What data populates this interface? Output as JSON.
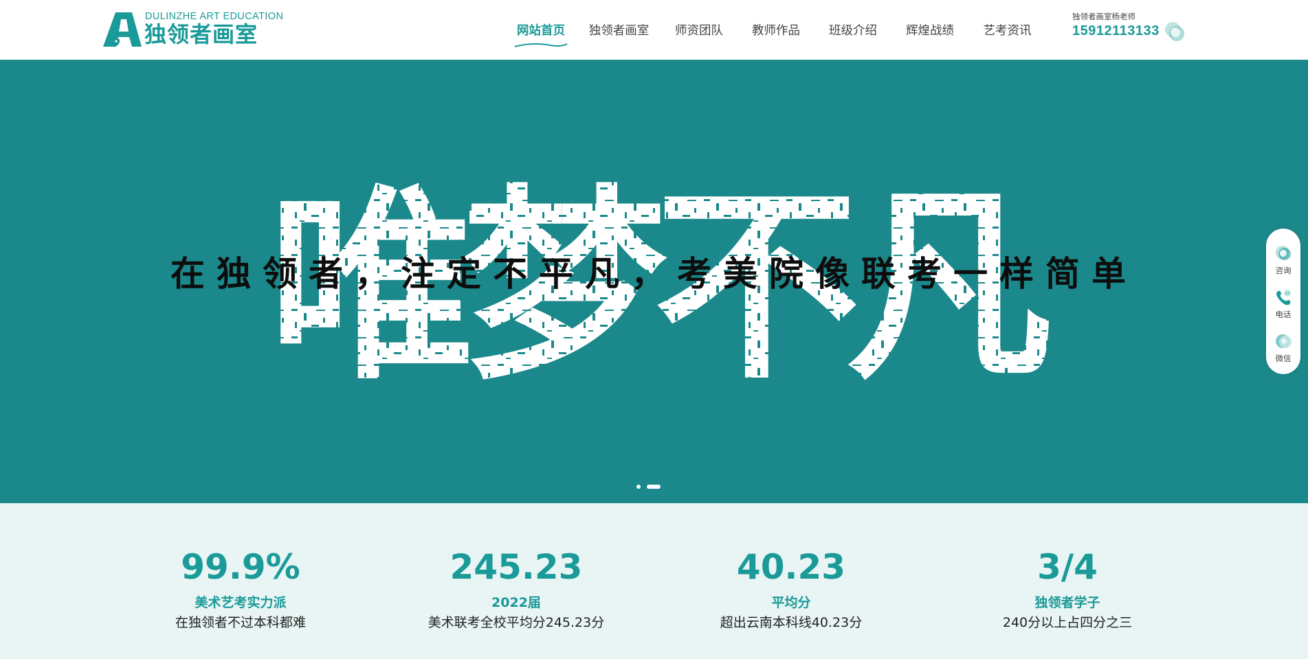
{
  "logo": {
    "en": "DULINZHE ART EDUCATION",
    "cn": "独领者画室"
  },
  "nav": {
    "items": [
      {
        "label": "网站首页",
        "active": true
      },
      {
        "label": "独领者画室",
        "active": false
      },
      {
        "label": "师资团队",
        "active": false
      },
      {
        "label": "教师作品",
        "active": false
      },
      {
        "label": "班级介绍",
        "active": false
      },
      {
        "label": "辉煌战绩",
        "active": false
      },
      {
        "label": "艺考资讯",
        "active": false
      }
    ]
  },
  "contact": {
    "label": "独领者画室杨老师",
    "phone": "15912113133"
  },
  "banner": {
    "headline": "唯梦不凡",
    "subtitle": "在独领者，注定不平凡，考美院像联考一样简单",
    "slides": 2,
    "active_slide": 2
  },
  "float_bar": {
    "items": [
      {
        "label": "咨询",
        "icon": "chat-icon"
      },
      {
        "label": "电话",
        "icon": "phone-icon"
      },
      {
        "label": "微信",
        "icon": "wechat-icon"
      }
    ]
  },
  "stats": [
    {
      "value": "99.9%",
      "title": "美术艺考实力派",
      "desc": "在独领者不过本科都难"
    },
    {
      "value": "245.23",
      "title": "2022届",
      "desc": "美术联考全校平均分245.23分"
    },
    {
      "value": "40.23",
      "title": "平均分",
      "desc": "超出云南本科线40.23分"
    },
    {
      "value": "3/4",
      "title": "独领者学子",
      "desc": "240分以上占四分之三"
    }
  ],
  "colors": {
    "brand": "#1a9a98",
    "banner_bg": "#1b898b",
    "stats_bg": "#e8f5f4"
  }
}
